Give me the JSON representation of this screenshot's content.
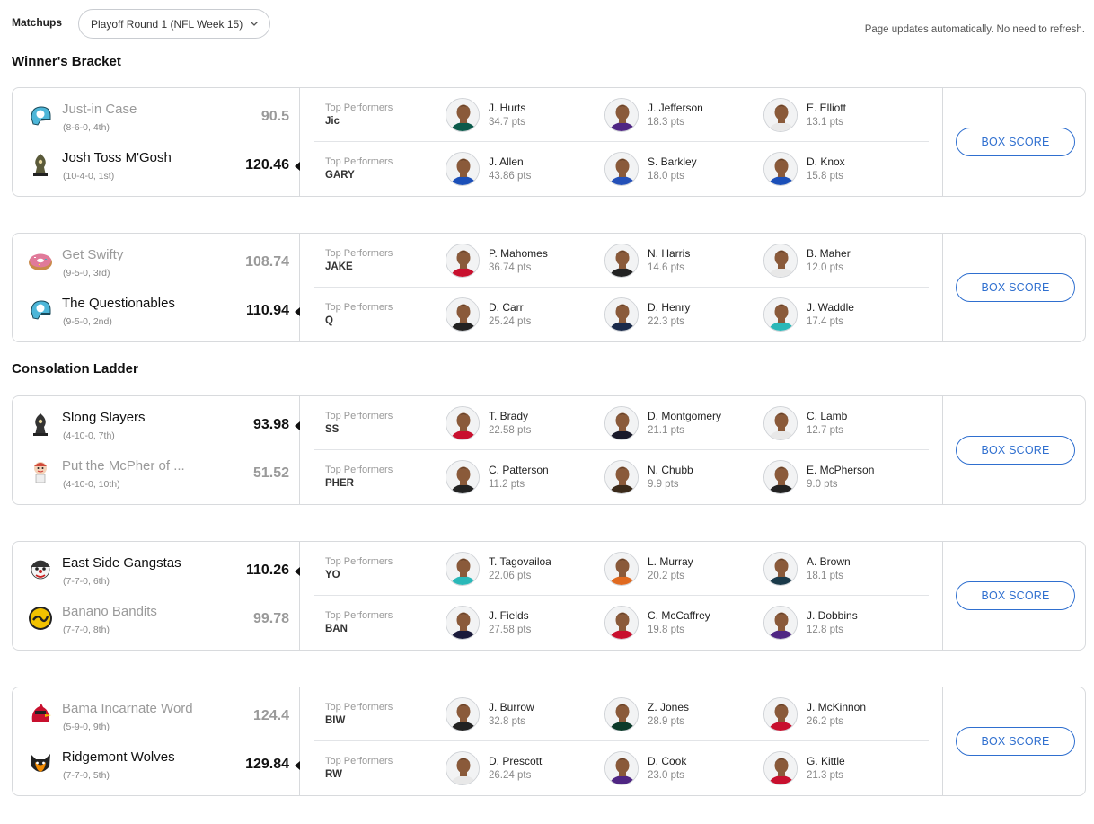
{
  "header": {
    "matchups_label": "Matchups",
    "week_selected": "Playoff Round 1 (NFL Week 15)",
    "auto_update_note": "Page updates automatically. No need to refresh."
  },
  "sections": {
    "winners": "Winner's Bracket",
    "consolation": "Consolation Ladder"
  },
  "top_performers_label": "Top Performers",
  "box_score_label": "BOX SCORE",
  "matchups": [
    {
      "team1": {
        "name": "Just-in Case",
        "record": "(8-6-0, 4th)",
        "score": "90.5",
        "abbr": "Jic",
        "winner": false,
        "logo_color": "#4db6d8",
        "logo_icon": "helmet-icon",
        "players": [
          {
            "name": "J. Hurts",
            "pts": "34.7 pts",
            "jersey": "#0b5a4a"
          },
          {
            "name": "J. Jefferson",
            "pts": "18.3 pts",
            "jersey": "#4f2683"
          },
          {
            "name": "E. Elliott",
            "pts": "13.1 pts",
            "jersey": "#e8e8e8"
          }
        ]
      },
      "team2": {
        "name": "Josh Toss M'Gosh",
        "record": "(10-4-0, 1st)",
        "score": "120.46",
        "abbr": "GARY",
        "winner": true,
        "logo_color": "#5a5a3a",
        "logo_icon": "knight-icon",
        "players": [
          {
            "name": "J. Allen",
            "pts": "43.86 pts",
            "jersey": "#1b4fb8"
          },
          {
            "name": "S. Barkley",
            "pts": "18.0 pts",
            "jersey": "#2450b8"
          },
          {
            "name": "D. Knox",
            "pts": "15.8 pts",
            "jersey": "#1b4fb8"
          }
        ]
      }
    },
    {
      "team1": {
        "name": "Get Swifty",
        "record": "(9-5-0, 3rd)",
        "score": "108.74",
        "abbr": "JAKE",
        "winner": false,
        "logo_color": "#e07a9a",
        "logo_icon": "donut-icon",
        "players": [
          {
            "name": "P. Mahomes",
            "pts": "36.74 pts",
            "jersey": "#c8102e"
          },
          {
            "name": "N. Harris",
            "pts": "14.6 pts",
            "jersey": "#222222"
          },
          {
            "name": "B. Maher",
            "pts": "12.0 pts",
            "jersey": "#e8e8e8"
          }
        ]
      },
      "team2": {
        "name": "The Questionables",
        "record": "(9-5-0, 2nd)",
        "score": "110.94",
        "abbr": "Q",
        "winner": true,
        "logo_color": "#4db6d8",
        "logo_icon": "helmet-icon",
        "players": [
          {
            "name": "D. Carr",
            "pts": "25.24 pts",
            "jersey": "#222222"
          },
          {
            "name": "D. Henry",
            "pts": "22.3 pts",
            "jersey": "#1a2a4a"
          },
          {
            "name": "J. Waddle",
            "pts": "17.4 pts",
            "jersey": "#2ab8b8"
          }
        ]
      }
    },
    {
      "team1": {
        "name": "Slong Slayers",
        "record": "(4-10-0, 7th)",
        "score": "93.98",
        "abbr": "SS",
        "winner": true,
        "logo_color": "#333333",
        "logo_icon": "knight-icon",
        "players": [
          {
            "name": "T. Brady",
            "pts": "22.58 pts",
            "jersey": "#c8102e"
          },
          {
            "name": "D. Montgomery",
            "pts": "21.1 pts",
            "jersey": "#1a1a2a"
          },
          {
            "name": "C. Lamb",
            "pts": "12.7 pts",
            "jersey": "#e8e8e8"
          }
        ]
      },
      "team2": {
        "name": "Put the McPher of ...",
        "record": "(4-10-0, 10th)",
        "score": "51.52",
        "abbr": "PHER",
        "winner": false,
        "logo_color": "#d04a3a",
        "logo_icon": "mascot-icon",
        "players": [
          {
            "name": "C. Patterson",
            "pts": "11.2 pts",
            "jersey": "#222222"
          },
          {
            "name": "N. Chubb",
            "pts": "9.9 pts",
            "jersey": "#3a2a1a"
          },
          {
            "name": "E. McPherson",
            "pts": "9.0 pts",
            "jersey": "#222222"
          }
        ]
      }
    },
    {
      "team1": {
        "name": "East Side Gangstas",
        "record": "(7-7-0, 6th)",
        "score": "110.26",
        "abbr": "YO",
        "winner": true,
        "logo_color": "#c81e1e",
        "logo_icon": "clown-icon",
        "players": [
          {
            "name": "T. Tagovailoa",
            "pts": "22.06 pts",
            "jersey": "#2ab8b8"
          },
          {
            "name": "L. Murray",
            "pts": "20.2 pts",
            "jersey": "#e06a20"
          },
          {
            "name": "A. Brown",
            "pts": "18.1 pts",
            "jersey": "#1a3a4a"
          }
        ]
      },
      "team2": {
        "name": "Banano Bandits",
        "record": "(7-7-0, 8th)",
        "score": "99.78",
        "abbr": "BAN",
        "winner": false,
        "logo_color": "#f2c200",
        "logo_icon": "banana-icon",
        "players": [
          {
            "name": "J. Fields",
            "pts": "27.58 pts",
            "jersey": "#1a1a3a"
          },
          {
            "name": "C. McCaffrey",
            "pts": "19.8 pts",
            "jersey": "#c8102e"
          },
          {
            "name": "J. Dobbins",
            "pts": "12.8 pts",
            "jersey": "#4f2683"
          }
        ]
      }
    },
    {
      "team1": {
        "name": "Bama Incarnate Word",
        "record": "(5-9-0, 9th)",
        "score": "124.4",
        "abbr": "BIW",
        "winner": false,
        "logo_color": "#c8102e",
        "logo_icon": "cardinal-icon",
        "players": [
          {
            "name": "J. Burrow",
            "pts": "32.8 pts",
            "jersey": "#222222"
          },
          {
            "name": "Z. Jones",
            "pts": "28.9 pts",
            "jersey": "#0b3a2a"
          },
          {
            "name": "J. McKinnon",
            "pts": "26.2 pts",
            "jersey": "#c8102e"
          }
        ]
      },
      "team2": {
        "name": "Ridgemont Wolves",
        "record": "(7-7-0, 5th)",
        "score": "129.84",
        "abbr": "RW",
        "winner": true,
        "logo_color": "#f28a00",
        "logo_icon": "wolf-icon",
        "players": [
          {
            "name": "D. Prescott",
            "pts": "26.24 pts",
            "jersey": "#e8e8e8"
          },
          {
            "name": "D. Cook",
            "pts": "23.0 pts",
            "jersey": "#4f2683"
          },
          {
            "name": "G. Kittle",
            "pts": "21.3 pts",
            "jersey": "#c8102e"
          }
        ]
      }
    }
  ]
}
